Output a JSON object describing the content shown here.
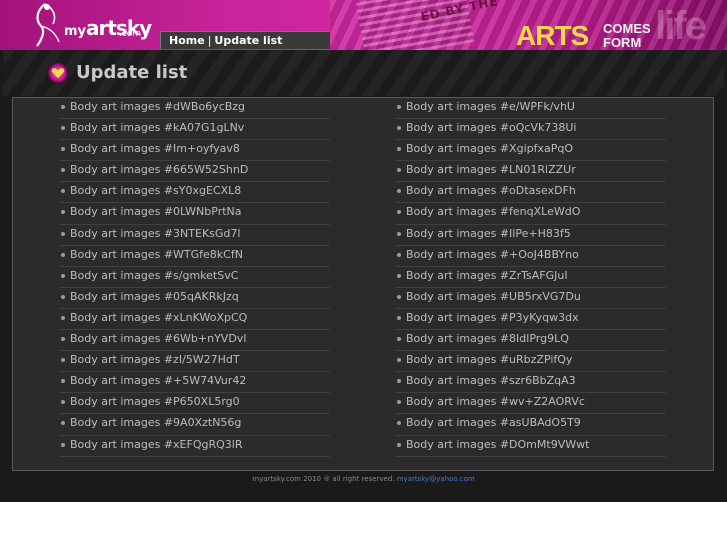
{
  "header": {
    "logo": {
      "my": "my",
      "art": "artsky",
      "dotcom": ".com"
    },
    "breadcrumb": {
      "home": "Home",
      "separator": "|",
      "current": "Update list"
    },
    "slogan": {
      "arts": "ARTS",
      "comes": "COMES",
      "form": "FORM",
      "life": "life"
    },
    "stamp_text": "ED BY THE"
  },
  "page": {
    "title": "Update list",
    "title_icon": "heart-icon"
  },
  "updates": {
    "left": [
      "Body art images #dWBo6ycBzg",
      "Body art images #kA07G1gLNv",
      "Body art images #Im+oyfyav8",
      "Body art images #665W52ShnD",
      "Body art images #sY0xgECXL8",
      "Body art images #0LWNbPrtNa",
      "Body art images #3NTEKsGd7l",
      "Body art images #WTGfe8kCfN",
      "Body art images #s/gmketSvC",
      "Body art images #05qAKRkJzq",
      "Body art images #xLnKWoXpCQ",
      "Body art images #6Wb+nYVDvl",
      "Body art images #zI/5W27HdT",
      "Body art images #+5W74Vur42",
      "Body art images #P650XL5rg0",
      "Body art images #9A0XztN56g",
      "Body art images #xEFQgRQ3lR"
    ],
    "right": [
      "Body art images #e/WPFk/vhU",
      "Body art images #oQcVk738Ui",
      "Body art images #XgipfxaPqO",
      "Body art images #LN01RlZZUr",
      "Body art images #oDtasexDFh",
      "Body art images #fenqXLeWdO",
      "Body art images #IlPe+H83f5",
      "Body art images #+OoJ4BBYno",
      "Body art images #ZrTsAFGJuI",
      "Body art images #UB5rxVG7Du",
      "Body art images #P3yKyqw3dx",
      "Body art images #8IdlPrg9LQ",
      "Body art images #uRbzZPifQy",
      "Body art images #szr6BbZqA3",
      "Body art images #wv+Z2AORVc",
      "Body art images #asUBAdO5T9",
      "Body art images #DOmMt9VWwt"
    ]
  },
  "footer": {
    "text": "myartsky.com 2010 ® all right reserved.",
    "email": "myartsky@yahoo.com"
  },
  "colors": {
    "header_magenta": "#c8239a",
    "accent_yellow": "#f6d94a",
    "background_dark": "#1a1a1a",
    "panel": "#2b2b2b",
    "link_blue": "#4a78c8"
  }
}
